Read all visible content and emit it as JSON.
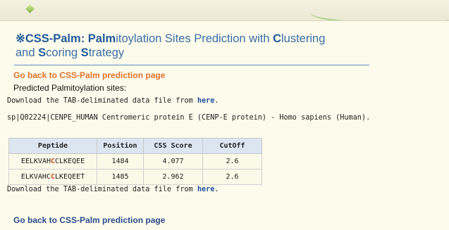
{
  "header": {
    "decor": "green-diamond-icon"
  },
  "title": {
    "prefix": "※",
    "parts": [
      {
        "text": "CSS-",
        "bold": true
      },
      {
        "text": "Palm",
        "bold": true
      },
      {
        "text": ": ",
        "bold": true
      },
      {
        "text": "Palm",
        "bold": true
      },
      {
        "text": "itoylation Sites Prediction with ",
        "bold": false
      },
      {
        "text": "C",
        "bold": true
      },
      {
        "text": "lustering",
        "bold": false
      }
    ],
    "line2_parts": [
      {
        "text": "and ",
        "bold": false
      },
      {
        "text": "S",
        "bold": true
      },
      {
        "text": "coring ",
        "bold": false
      },
      {
        "text": "S",
        "bold": true
      },
      {
        "text": "trategy",
        "bold": false
      }
    ]
  },
  "links": {
    "back_top": "Go back to CSS-Palm prediction page",
    "back_bottom": "Go back to CSS-Palm prediction page"
  },
  "predicted_label": "Predicted Palmitoylation sites:",
  "download": {
    "prefix": "Download the TAB-deliminated data file from ",
    "link": "here",
    "suffix": "."
  },
  "protein_line": "sp|Q02224|CENPE_HUMAN Centromeric protein E (CENP-E protein) - Homo sapiens (Human).",
  "table": {
    "headers": [
      "Peptide",
      "Position",
      "CSS Score",
      "CutOff"
    ],
    "rows": [
      {
        "peptide_pre": "EELKVAH",
        "peptide_site": "C",
        "peptide_post": "CLKEQEE",
        "position": "1484",
        "score": "4.077",
        "cutoff": "2.6"
      },
      {
        "peptide_pre": "ELKVAHC",
        "peptide_site": "C",
        "peptide_post": "LKEQEET",
        "position": "1485",
        "score": "2.962",
        "cutoff": "2.6"
      }
    ]
  },
  "colors": {
    "background": "#fdfbec",
    "title": "#3a6ea6",
    "back_link_top": "#e0722c",
    "back_link_bottom": "#2b4c8c",
    "site_highlight": "#d4441a"
  }
}
